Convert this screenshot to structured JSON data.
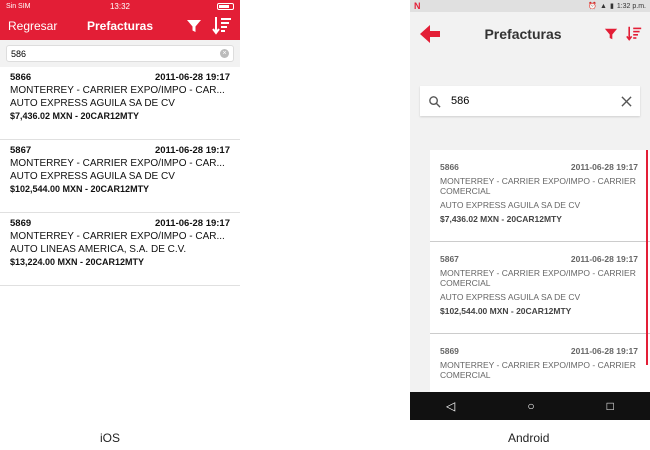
{
  "ios": {
    "status": {
      "carrier": "Sin SIM",
      "time": "13:32"
    },
    "nav": {
      "back_label": "Regresar",
      "title": "Prefacturas"
    },
    "search": {
      "value": "586"
    },
    "items": [
      {
        "id": "5866",
        "date": "2011-06-28 19:17",
        "line1": "MONTERREY - CARRIER EXPO/IMPO - CAR...",
        "line2": "AUTO EXPRESS AGUILA SA DE CV",
        "amount": "$7,436.02 MXN - 20CAR12MTY"
      },
      {
        "id": "5867",
        "date": "2011-06-28 19:17",
        "line1": "MONTERREY - CARRIER EXPO/IMPO - CAR...",
        "line2": "AUTO EXPRESS AGUILA SA DE CV",
        "amount": "$102,544.00 MXN - 20CAR12MTY"
      },
      {
        "id": "5869",
        "date": "2011-06-28 19:17",
        "line1": "MONTERREY - CARRIER EXPO/IMPO - CAR...",
        "line2": "AUTO LINEAS AMERICA, S.A. DE C.V.",
        "amount": "$13,224.00 MXN - 20CAR12MTY"
      }
    ]
  },
  "android": {
    "status": {
      "time": "1:32 p.m."
    },
    "toolbar": {
      "title": "Prefacturas"
    },
    "search": {
      "value": "586"
    },
    "items": [
      {
        "id": "5866",
        "date": "2011-06-28 19:17",
        "line1": "MONTERREY - CARRIER EXPO/IMPO - CARRIER COMERCIAL",
        "line2": "AUTO EXPRESS AGUILA SA DE CV",
        "amount": "$7,436.02 MXN - 20CAR12MTY"
      },
      {
        "id": "5867",
        "date": "2011-06-28 19:17",
        "line1": "MONTERREY - CARRIER EXPO/IMPO - CARRIER COMERCIAL",
        "line2": "AUTO EXPRESS AGUILA SA DE CV",
        "amount": "$102,544.00 MXN - 20CAR12MTY"
      },
      {
        "id": "5869",
        "date": "2011-06-28 19:17",
        "line1": "MONTERREY - CARRIER EXPO/IMPO - CARRIER COMERCIAL",
        "line2": "",
        "amount": ""
      }
    ]
  },
  "captions": {
    "ios": "iOS",
    "android": "Android"
  },
  "colors": {
    "accent": "#e31e36"
  },
  "icons": [
    "filter-icon",
    "sort-icon",
    "back-arrow-icon",
    "search-icon",
    "clear-icon",
    "nav-back-icon",
    "nav-home-icon",
    "nav-recents-icon"
  ]
}
